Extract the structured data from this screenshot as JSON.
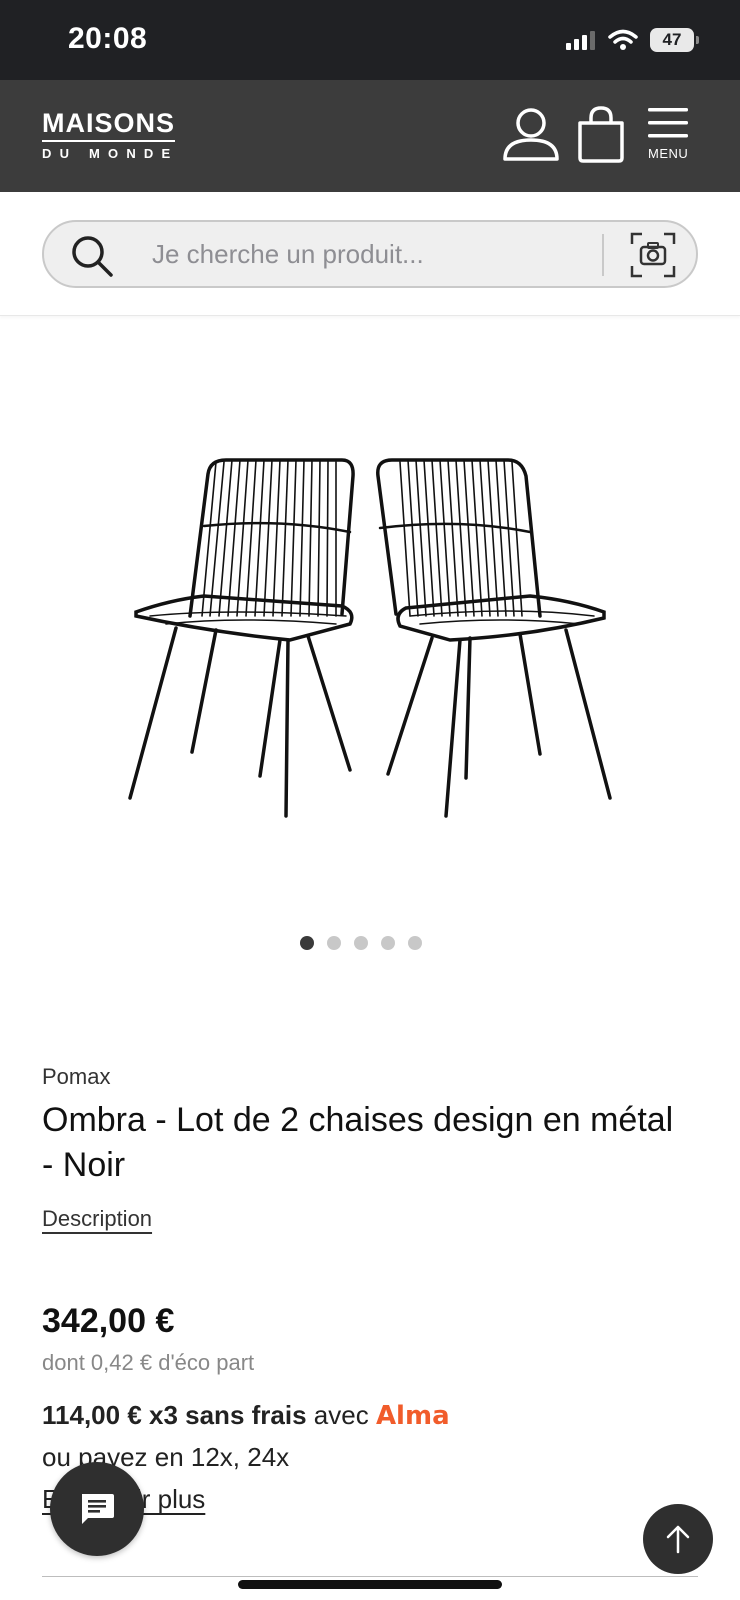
{
  "status_bar": {
    "time": "20:08",
    "battery": "47",
    "icons": [
      "signal-icon",
      "wifi-icon",
      "battery-icon"
    ]
  },
  "header": {
    "logo_top": "MAISONS",
    "logo_bottom": "DU MONDE",
    "menu_label": "MENU",
    "icons": [
      "account-icon",
      "cart-icon",
      "menu-icon"
    ],
    "background": "#3c3c3c"
  },
  "search": {
    "placeholder": "Je cherche un produit...",
    "icons": [
      "search-icon",
      "camera-icon"
    ]
  },
  "carousel": {
    "slide_count": 5,
    "active_index": 0
  },
  "product": {
    "brand": "Pomax",
    "title": "Ombra - Lot de 2 chaises design en métal - Noir",
    "description_link": "Description",
    "price": "342,00 €",
    "eco_part": "dont 0,42 € d'éco part",
    "installment": "114,00 € x3 sans frais",
    "installment_with": "avec",
    "installment_provider": "Alma",
    "other_options": "ou payez en 12x, 24x",
    "learn_more": "En savoir plus"
  },
  "fabs": {
    "icons": [
      "chat-icon",
      "arrow-up-icon"
    ]
  },
  "colors": {
    "status_bar": "#202124",
    "accent_alma": "#f15c2b",
    "fab": "#2f2f2f"
  }
}
